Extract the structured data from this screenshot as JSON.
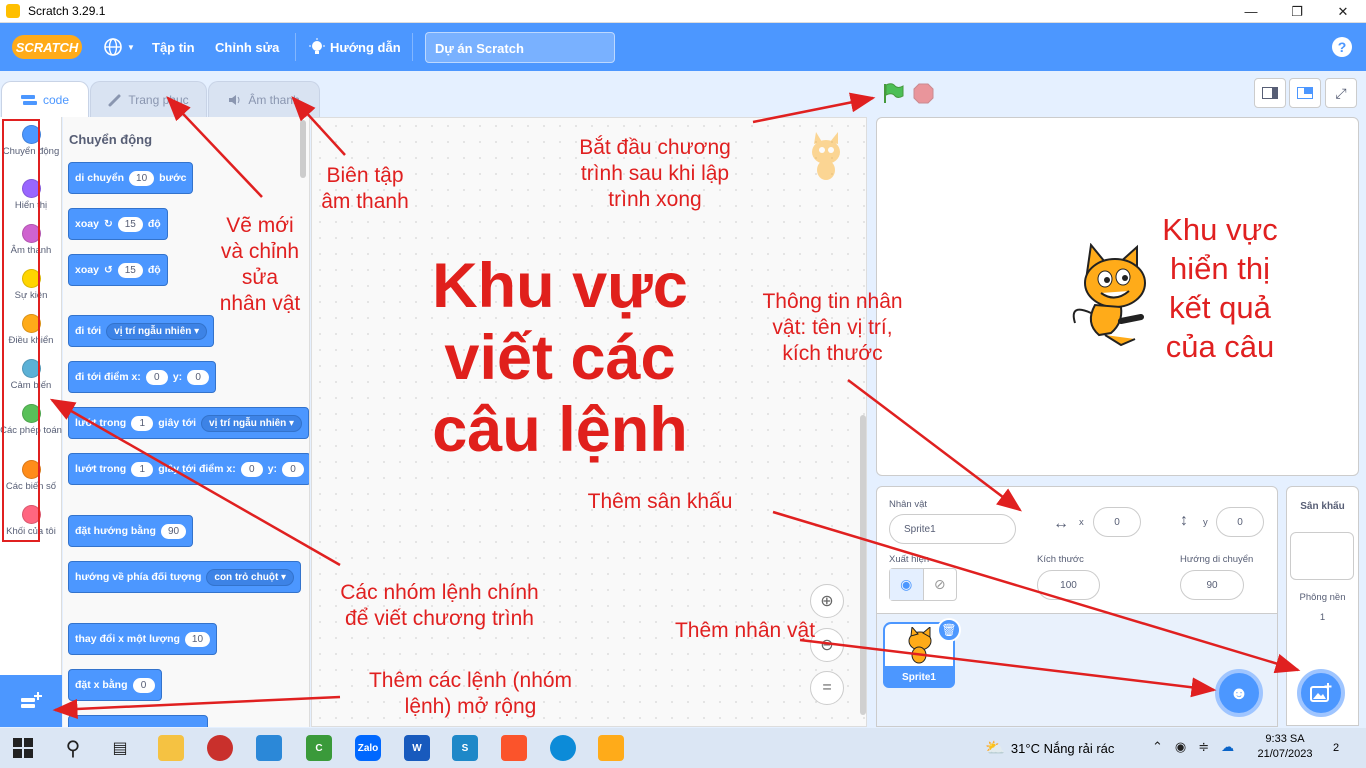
{
  "window": {
    "title": "Scratch 3.29.1"
  },
  "menu": {
    "logo": "SCRATCH",
    "file": "Tập tin",
    "edit": "Chỉnh sửa",
    "tutorials": "Hướng dẫn",
    "project_title": "Dự án Scratch"
  },
  "tabs": {
    "code": "code",
    "costumes": "Trang phục",
    "sounds": "Âm thanh"
  },
  "categories": [
    {
      "label": "Chuyển động",
      "color": "#4c97ff"
    },
    {
      "label": "Hiển thị",
      "color": "#9966ff"
    },
    {
      "label": "Âm thanh",
      "color": "#cf63cf"
    },
    {
      "label": "Sự kiện",
      "color": "#ffd500"
    },
    {
      "label": "Điều khiển",
      "color": "#ffab19"
    },
    {
      "label": "Cảm biến",
      "color": "#5cb1d6"
    },
    {
      "label": "Các phép toán",
      "color": "#59c059"
    },
    {
      "label": "Các biến số",
      "color": "#ff8c1a"
    },
    {
      "label": "Khối của tôi",
      "color": "#ff6680"
    }
  ],
  "palette": {
    "heading": "Chuyển động",
    "move": {
      "text": "di chuyển",
      "value": "10",
      "suffix": "bước"
    },
    "turn_right": {
      "text": "xoay",
      "value": "15",
      "suffix": "độ"
    },
    "turn_left": {
      "text": "xoay",
      "value": "15",
      "suffix": "độ"
    },
    "goto": {
      "text": "đi tới",
      "menu": "vị trí ngẫu nhiên"
    },
    "goto_xy": {
      "text": "đi tới điểm x:",
      "x": "0",
      "ylabel": "y:",
      "y": "0"
    },
    "glide": {
      "text": "lướt trong",
      "value": "1",
      "mid": "giây tới",
      "menu": "vị trí ngẫu nhiên"
    },
    "glide_xy": {
      "text": "lướt trong",
      "value": "1",
      "mid": "giây tới điểm x:",
      "x": "0",
      "ylabel": "y:",
      "y": "0"
    },
    "point_dir": {
      "text": "đặt hướng bằng",
      "value": "90"
    },
    "point_towards": {
      "text": "hướng về phía đối tượng",
      "menu": "con trỏ chuột"
    },
    "change_x": {
      "text": "thay đổi x một lượng",
      "value": "10"
    },
    "set_x": {
      "text": "đặt x bằng",
      "value": "0"
    }
  },
  "sprite_info": {
    "sprite_label": "Nhân vật",
    "sprite_name": "Sprite1",
    "x_label": "x",
    "x": "0",
    "y_label": "y",
    "y": "0",
    "show_label": "Xuất hiện",
    "size_label": "Kích thước",
    "size": "100",
    "direction_label": "Hướng di chuyển",
    "direction": "90",
    "thumb_name": "Sprite1"
  },
  "stage_pane": {
    "title": "Sân khấu",
    "backdrops_label": "Phông nền",
    "backdrops_count": "1"
  },
  "annotations": {
    "costume_edit": "Vẽ mới\nvà chỉnh\nsửa\nnhân vật",
    "sound_edit": "Biên tập\nâm thanh",
    "start": "Bắt đầu chương\ntrình sau khi lập\ntrình xong",
    "main_area": "Khu vực\nviết các\ncâu lệnh",
    "result_area": "Khu vực\nhiển thị\nkết quả\ncủa câu",
    "sprite_info": "Thông tin nhân\nvật: tên vị trí,\nkích thước",
    "add_stage": "Thêm sân khấu",
    "command_groups": "Các nhóm lệnh chính\nđể viết chương trình",
    "add_sprite": "Thêm nhân vật",
    "extensions": "Thêm các lệnh (nhóm\nlệnh) mở rộng"
  },
  "taskbar": {
    "weather": "31°C  Nắng rải rác",
    "time": "9:33 SA",
    "date": "21/07/2023",
    "notifications": "2"
  },
  "colors": {
    "scratch_blue": "#4c97ff",
    "annotation_red": "#e02020",
    "motion_block": "#4c97ff"
  }
}
